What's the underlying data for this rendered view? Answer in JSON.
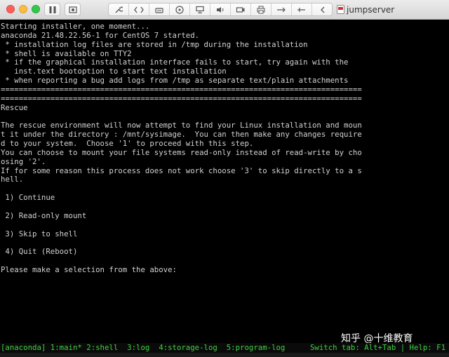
{
  "window": {
    "title": "jumpserver",
    "toolbar_icons": [
      "pause-icon",
      "screenshot-icon",
      "wrench-icon",
      "code-icon",
      "disk-icon",
      "cdrom-icon",
      "audio-icon",
      "camera-icon",
      "printer-icon",
      "usb-icon",
      "usb-alt-icon",
      "collapse-icon"
    ]
  },
  "terminal": {
    "lines": [
      "Starting installer, one moment...",
      "anaconda 21.48.22.56-1 for CentOS 7 started.",
      " * installation log files are stored in /tmp during the installation",
      " * shell is available on TTY2",
      " * if the graphical installation interface fails to start, try again with the",
      "   inst.text bootoption to start text installation",
      " * when reporting a bug add logs from /tmp as separate text/plain attachments",
      "================================================================================",
      "================================================================================",
      "Rescue",
      "",
      "The rescue environment will now attempt to find your Linux installation and moun",
      "t it under the directory : /mnt/sysimage.  You can then make any changes require",
      "d to your system.  Choose '1' to proceed with this step.",
      "You can choose to mount your file systems read-only instead of read-write by cho",
      "osing '2'.",
      "If for some reason this process does not work choose '3' to skip directly to a s",
      "hell.",
      "",
      " 1) Continue",
      "",
      " 2) Read-only mount",
      "",
      " 3) Skip to shell",
      "",
      " 4) Quit (Reboot)",
      "",
      "Please make a selection from the above:"
    ]
  },
  "statusbar": {
    "left": "[anaconda] 1:main* 2:shell  3:log  4:storage-log  5:program-log",
    "right": "Switch tab: Alt+Tab | Help: F1"
  },
  "watermark": "知乎 @十维教育"
}
